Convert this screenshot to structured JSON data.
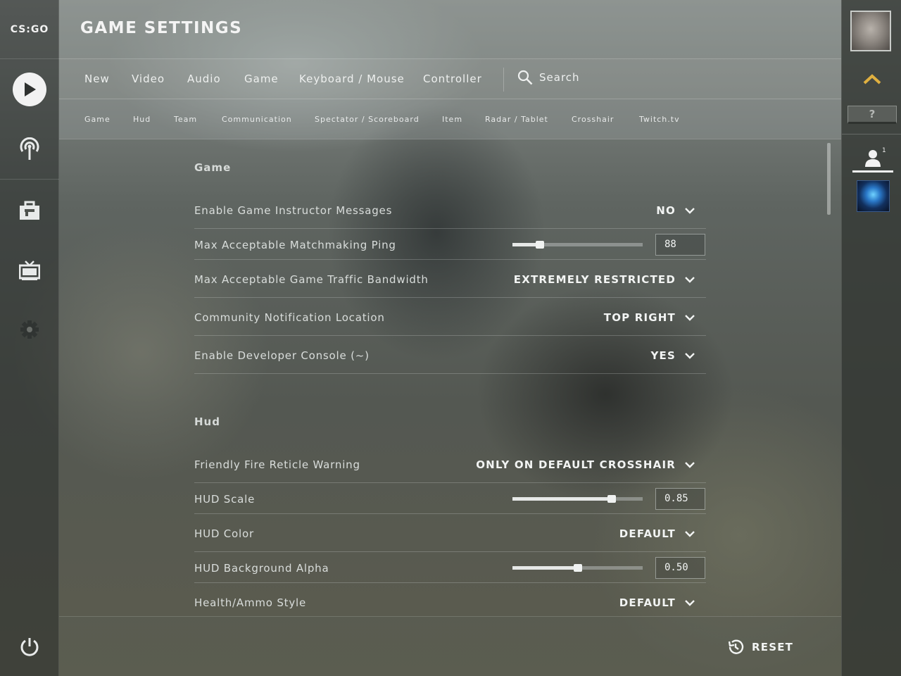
{
  "app": {
    "logo_text": "CS:GO",
    "title": "GAME SETTINGS"
  },
  "sidebar": {
    "items": [
      {
        "icon": "play-icon"
      },
      {
        "icon": "broadcast-icon"
      },
      {
        "icon": "inventory-icon"
      },
      {
        "icon": "tv-icon"
      },
      {
        "icon": "gear-icon"
      },
      {
        "icon": "power-icon"
      }
    ]
  },
  "tabs": [
    "New",
    "Video",
    "Audio",
    "Game",
    "Keyboard / Mouse",
    "Controller"
  ],
  "search": {
    "label": "Search"
  },
  "subtabs": [
    "Game",
    "Hud",
    "Team",
    "Communication",
    "Spectator / Scoreboard",
    "Item",
    "Radar / Tablet",
    "Crosshair",
    "Twitch.tv"
  ],
  "sections": {
    "game": {
      "title": "Game",
      "rows": {
        "instructor": {
          "label": "Enable Game Instructor Messages",
          "value": "NO"
        },
        "ping": {
          "label": "Max Acceptable Matchmaking Ping",
          "value": "88",
          "slider_fraction": 0.21
        },
        "bandwidth": {
          "label": "Max Acceptable Game Traffic Bandwidth",
          "value": "EXTREMELY RESTRICTED"
        },
        "notification": {
          "label": "Community Notification Location",
          "value": "TOP RIGHT"
        },
        "console": {
          "label": "Enable Developer Console (~)",
          "value": "YES"
        }
      }
    },
    "hud": {
      "title": "Hud",
      "rows": {
        "ff_reticle": {
          "label": "Friendly Fire Reticle Warning",
          "value": "ONLY ON DEFAULT CROSSHAIR"
        },
        "hud_scale": {
          "label": "HUD Scale",
          "value": "0.85",
          "slider_fraction": 0.76
        },
        "hud_color": {
          "label": "HUD Color",
          "value": "DEFAULT"
        },
        "hud_alpha": {
          "label": "HUD Background Alpha",
          "value": "0.50",
          "slider_fraction": 0.5
        },
        "health_style": {
          "label": "Health/Ammo Style",
          "value": "DEFAULT"
        }
      }
    }
  },
  "footer": {
    "reset_label": "RESET"
  },
  "right_panel": {
    "help_label": "?",
    "friends_count": "1"
  }
}
